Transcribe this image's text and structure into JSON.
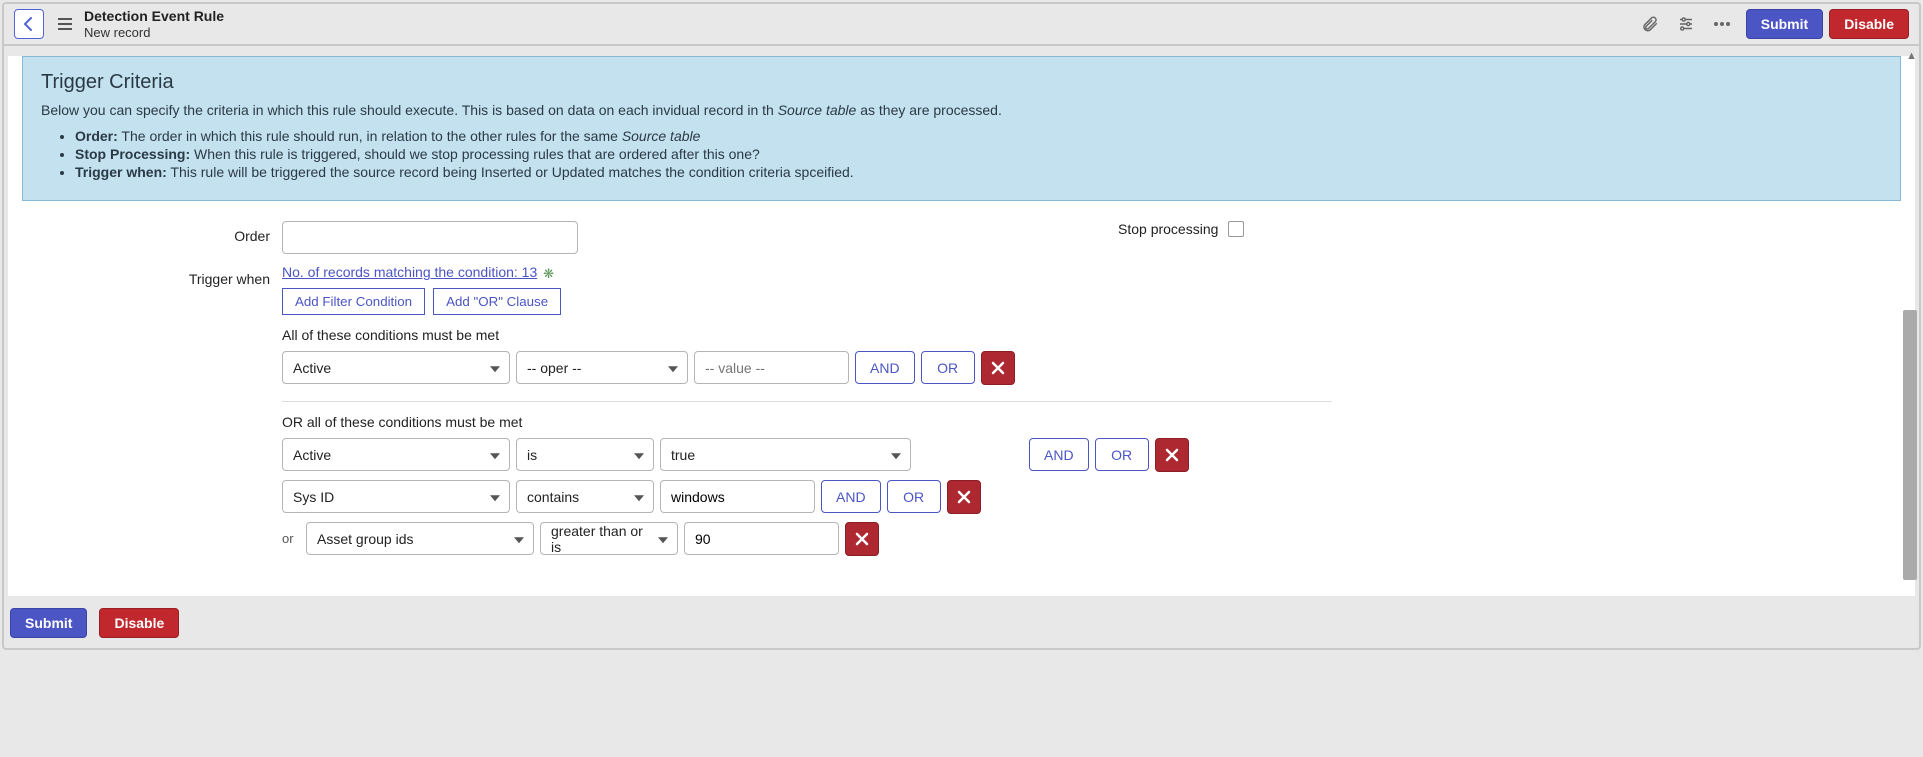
{
  "header": {
    "title": "Detection Event Rule",
    "subtitle": "New record",
    "submit_label": "Submit",
    "disable_label": "Disable"
  },
  "info": {
    "title": "Trigger Criteria",
    "description_prefix": "Below you can specify the criteria in which this rule should execute. This is based on data on each invidual record in th ",
    "description_em": "Source table",
    "description_suffix": " as they are processed.",
    "bullets": {
      "order": {
        "label": "Order:",
        "text_prefix": " The order in which this rule should run, in relation to the other rules for the same ",
        "text_em": "Source table"
      },
      "stop": {
        "label": "Stop Processing:",
        "text": " When this rule is triggered, should we stop processing rules that are ordered after this one?"
      },
      "trigger": {
        "label": "Trigger when:",
        "text": " This rule will be triggered the source record being Inserted or Updated matches the condition criteria spceified."
      }
    }
  },
  "form": {
    "order_label": "Order",
    "order_value": "",
    "stop_label": "Stop processing",
    "trigger_label": "Trigger when"
  },
  "filter": {
    "records_link": "No. of records matching the condition: 13",
    "add_filter_label": "Add Filter Condition",
    "add_or_label": "Add \"OR\" Clause",
    "all_label": "All of these conditions must be met",
    "or_all_label": "OR all of these conditions must be met",
    "and_label": "AND",
    "or_label": "OR",
    "or_prefix": "or",
    "group1": {
      "row1": {
        "field": "Active",
        "oper": "-- oper --",
        "value_placeholder": "-- value --"
      }
    },
    "group2": {
      "row1": {
        "field": "Active",
        "oper": "is",
        "value": "true"
      },
      "row2": {
        "field": "Sys ID",
        "oper": "contains",
        "value": "windows"
      },
      "row2or": {
        "field": "Asset group ids",
        "oper": "greater than or is",
        "value": "90"
      }
    }
  },
  "footer": {
    "submit_label": "Submit",
    "disable_label": "Disable"
  }
}
